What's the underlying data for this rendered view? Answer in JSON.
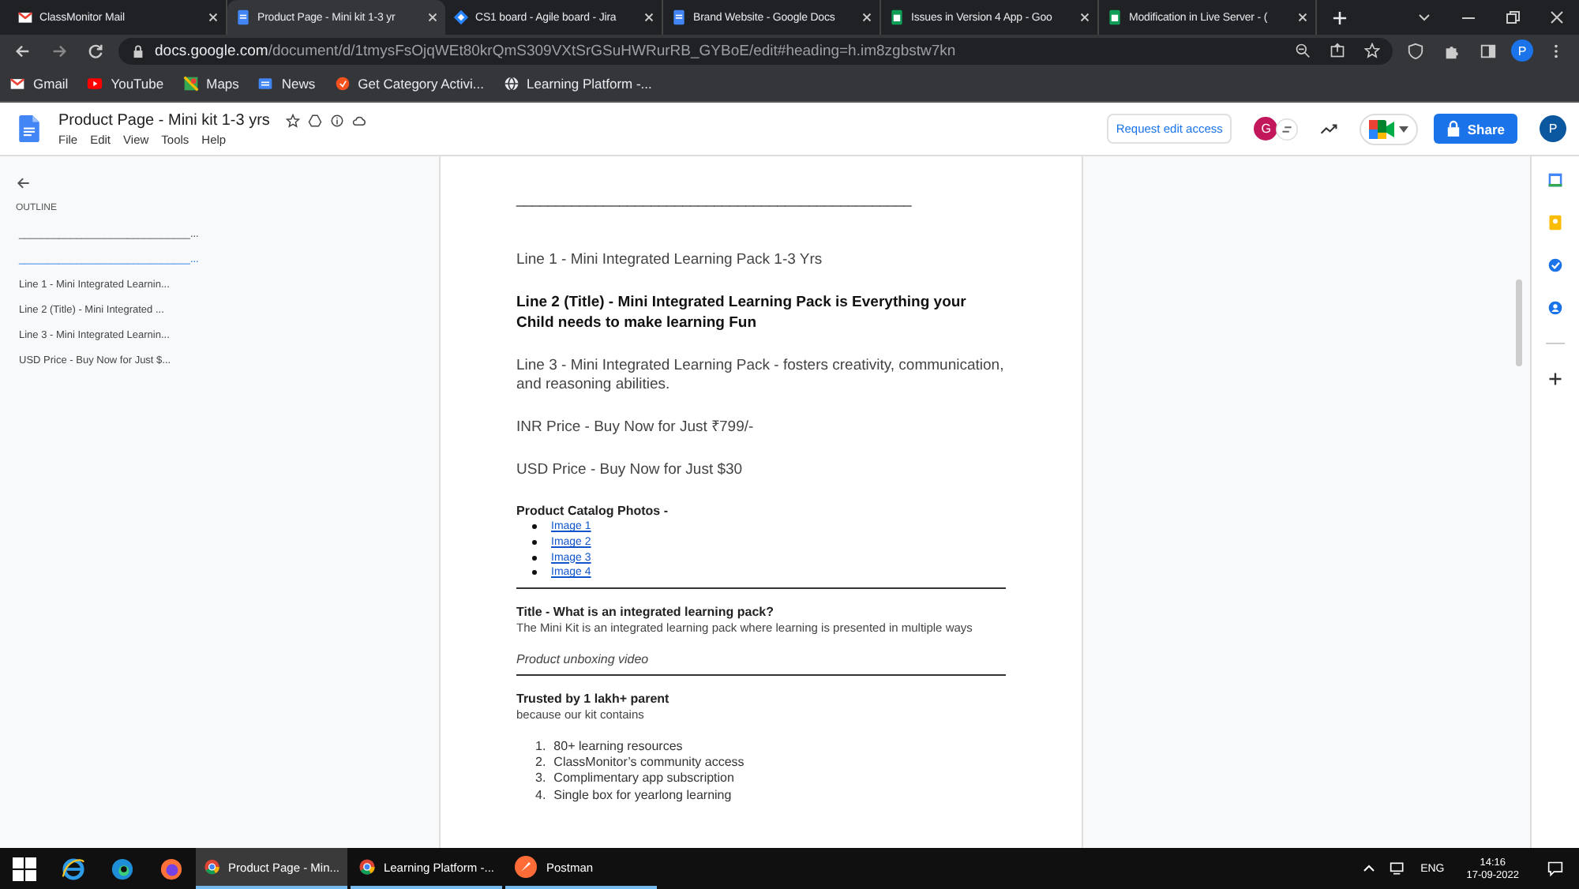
{
  "browser": {
    "tabs": [
      {
        "title": "ClassMonitor Mail",
        "selected": false
      },
      {
        "title": "Product Page - Mini kit 1-3 yr",
        "selected": true
      },
      {
        "title": "CS1 board - Agile board - Jira",
        "selected": false
      },
      {
        "title": "Brand Website - Google Docs",
        "selected": false
      },
      {
        "title": "Issues in Version 4 App - Goo",
        "selected": false
      },
      {
        "title": "Modification in Live Server - (",
        "selected": false
      }
    ],
    "url_host": "docs.google.com",
    "url_path": "/document/d/1tmysFsOjqWEt80krQmS309VXtSrGSuHWRurRB_GYBoE/edit#heading=h.im8zgbstw7kn",
    "profile": "P",
    "bookmarks": [
      "Gmail",
      "YouTube",
      "Maps",
      "News",
      "Get Category Activi...",
      "Learning Platform -..."
    ]
  },
  "docs": {
    "title": "Product Page - Mini kit 1-3 yrs",
    "menus": [
      "File",
      "Edit",
      "View",
      "Tools",
      "Help"
    ],
    "request_button": "Request edit access",
    "viewer_avatar": "G",
    "share_button": "Share",
    "account_avatar": "P"
  },
  "outline": {
    "heading": "OUTLINE",
    "items": [
      {
        "text": "______________________________...",
        "selected": false
      },
      {
        "text": "______________________________...",
        "selected": true
      },
      {
        "text": "Line 1 - Mini Integrated Learnin...",
        "selected": false
      },
      {
        "text": "Line 2 (Title) - Mini Integrated ...",
        "selected": false
      },
      {
        "text": "Line 3 - Mini Integrated Learnin...",
        "selected": false
      },
      {
        "text": "USD Price - Buy Now for Just $...",
        "selected": false
      }
    ]
  },
  "document": {
    "blocks": [
      {
        "kind": "rule-text",
        "text": "__________________________________________________"
      },
      {
        "kind": "para",
        "text": "Line 1 - Mini Integrated Learning Pack 1-3 Yrs"
      },
      {
        "kind": "title",
        "text": "Line 2 (Title) - Mini Integrated Learning Pack is Everything your Child needs to make learning Fun"
      },
      {
        "kind": "para",
        "text": "Line 3 - Mini Integrated Learning Pack - fosters creativity, communication, and reasoning abilities."
      },
      {
        "kind": "para",
        "text": "INR Price - Buy Now for Just ₹799/-"
      },
      {
        "kind": "para",
        "text": "USD Price - Buy Now for Just $30"
      },
      {
        "kind": "small-bold",
        "text": "Product Catalog Photos -"
      },
      {
        "kind": "links",
        "items": [
          "Image 1",
          "Image 2",
          "Image 3",
          "Image 4"
        ]
      },
      {
        "kind": "rule"
      },
      {
        "kind": "small-bold",
        "text": "Title - What is an integrated learning pack?"
      },
      {
        "kind": "small",
        "text": "The Mini Kit is an integrated learning pack where learning is presented in multiple ways"
      },
      {
        "kind": "italic",
        "text": "Product unboxing video"
      },
      {
        "kind": "rule"
      },
      {
        "kind": "small-bold",
        "text": "Trusted by 1 lakh+ parent"
      },
      {
        "kind": "small",
        "text": "because our kit contains"
      },
      {
        "kind": "numbered",
        "items": [
          {
            "num": "1.",
            "text": "80+ learning resources"
          },
          {
            "num": "2.",
            "text": "ClassMonitor’s community access"
          },
          {
            "num": "3.",
            "text": "Complimentary app subscription"
          },
          {
            "num": "4.",
            "text": "Single box for yearlong learning"
          }
        ]
      }
    ]
  },
  "taskbar": {
    "apps": [
      {
        "label": "Product Page - Min...",
        "selected": true
      },
      {
        "label": "Learning Platform -...",
        "selected": false
      },
      {
        "label": "Postman",
        "selected": false
      }
    ],
    "language": "ENG",
    "time": "14:16",
    "date": "17-09-2022"
  }
}
